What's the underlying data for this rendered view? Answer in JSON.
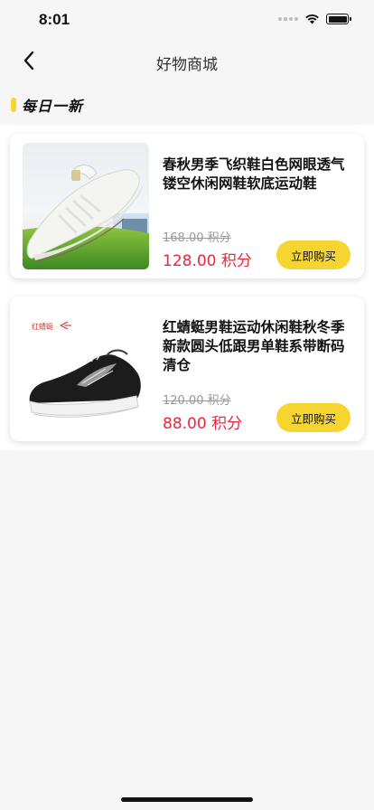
{
  "status_bar": {
    "time": "8:01"
  },
  "nav": {
    "title": "好物商城",
    "back_icon": "chevron-left-icon"
  },
  "section": {
    "title": "每日一新"
  },
  "products": [
    {
      "name": "春秋男季飞织鞋白色网眼透气镂空休闲网鞋软底运动鞋",
      "original_price": "168.00 积分",
      "price": "128.00 积分",
      "buy_label": "立即购买"
    },
    {
      "name": "红蜻蜓男鞋运动休闲鞋秋冬季新款圆头低跟男单鞋系带断码清仓",
      "original_price": "120.00 积分",
      "price": "88.00 积分",
      "buy_label": "立即购买",
      "brand_text": "红蜻蜓"
    }
  ],
  "colors": {
    "accent": "#f7d531",
    "price": "#e8283c",
    "background": "#f6f6f6"
  }
}
